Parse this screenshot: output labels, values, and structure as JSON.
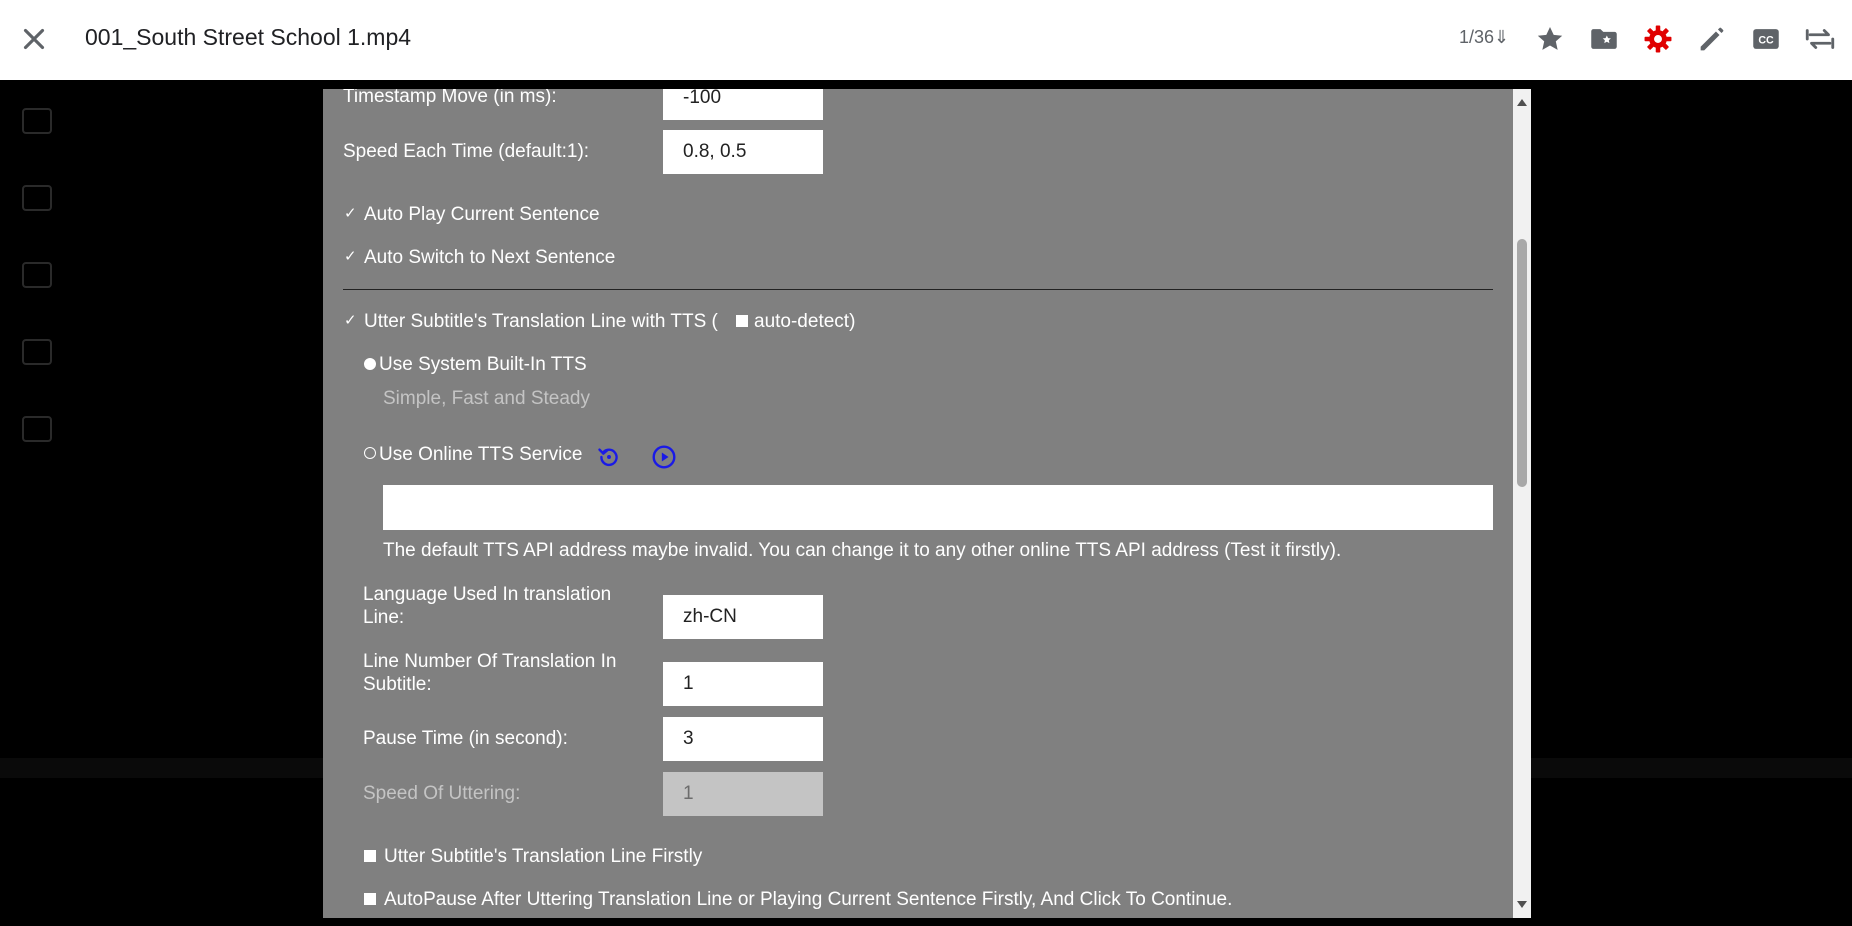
{
  "header": {
    "file_title": "001_South Street School 1.mp4",
    "counter": "1/36⇓",
    "icons": [
      "close-icon",
      "star-icon",
      "folder-star-icon",
      "gear-icon",
      "pencil-icon",
      "cc-icon",
      "repeat-icon"
    ],
    "settings_color": "#e00000"
  },
  "settings": {
    "timestamp_move_label": "Timestamp Move (in ms):",
    "timestamp_move_value": "-100",
    "speed_each_time_label": "Speed Each Time (default:1):",
    "speed_each_time_value": "0.8, 0.5",
    "auto_play_label": "Auto Play Current Sentence",
    "auto_switch_label": "Auto Switch to Next Sentence",
    "utter_tts_label": "Utter Subtitle's Translation Line with TTS (",
    "auto_detect_label": "auto-detect)",
    "system_tts_label": "Use System Built-In TTS",
    "system_tts_desc": "Simple, Fast and Steady",
    "online_tts_label": "Use Online TTS Service",
    "online_tts_url": "",
    "online_tts_note": "The default TTS API address maybe invalid. You can change it to any other online TTS API address (Test it firstly).",
    "language_label": "Language Used In translation Line:",
    "language_value": "zh-CN",
    "line_number_label": "Line Number Of Translation In Subtitle:",
    "line_number_value": "1",
    "pause_time_label": "Pause Time (in second):",
    "pause_time_value": "3",
    "speed_uttering_label": "Speed Of Uttering:",
    "speed_uttering_value": "1",
    "utter_firstly_label": "Utter Subtitle's Translation Line Firstly",
    "autopause_label": "AutoPause After Uttering Translation Line or Playing Current Sentence Firstly, And Click To Continue."
  },
  "colors": {
    "dialog_bg": "#808080",
    "accent_blue": "#1a1ae6"
  }
}
